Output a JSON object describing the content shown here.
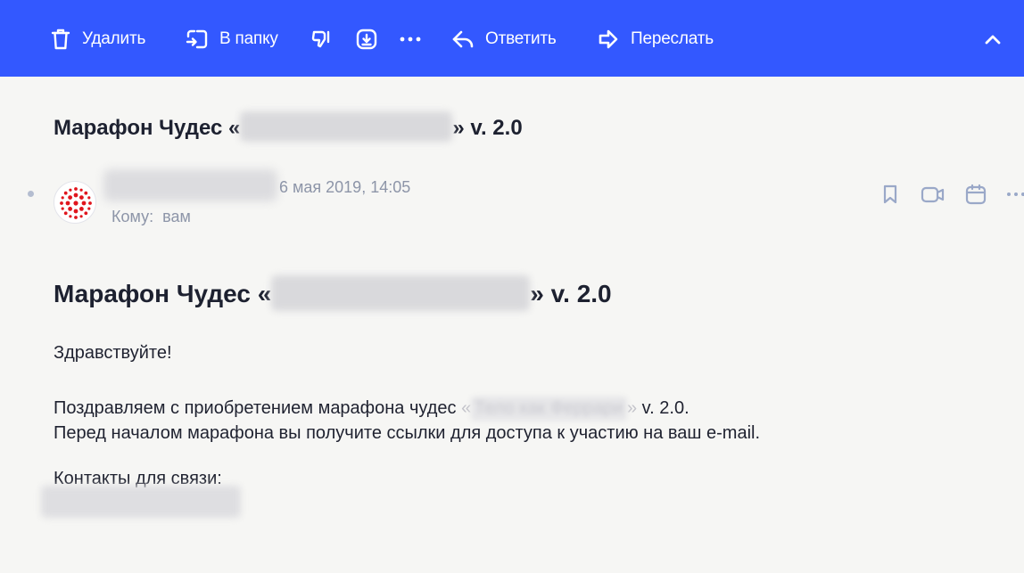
{
  "toolbar": {
    "delete_label": "Удалить",
    "move_label": "В папку",
    "forward_label": "Переслать",
    "reply_label": "Ответить",
    "bg_color": "#3358ff"
  },
  "message": {
    "subject_prefix": "Марафон Чудес «",
    "subject_suffix": "» v. 2.0",
    "date": "6 мая 2019, 14:05",
    "to_label": "Кому:",
    "to_value": "вам"
  },
  "body": {
    "title_prefix": "Марафон Чудес «",
    "title_suffix": "» v. 2.0",
    "greeting": "Здравствуйте!",
    "line1_prefix": "Поздравляем с приобретением марафона чудес ",
    "line1_open": "«",
    "line1_blurred": "Тело как Феррари",
    "line1_close": "»",
    "line1_suffix": " v. 2.0.",
    "line2": "Перед началом марафона вы получите ссылки для доступа к участию на ваш e-mail.",
    "contacts": "Контакты для связи:"
  }
}
